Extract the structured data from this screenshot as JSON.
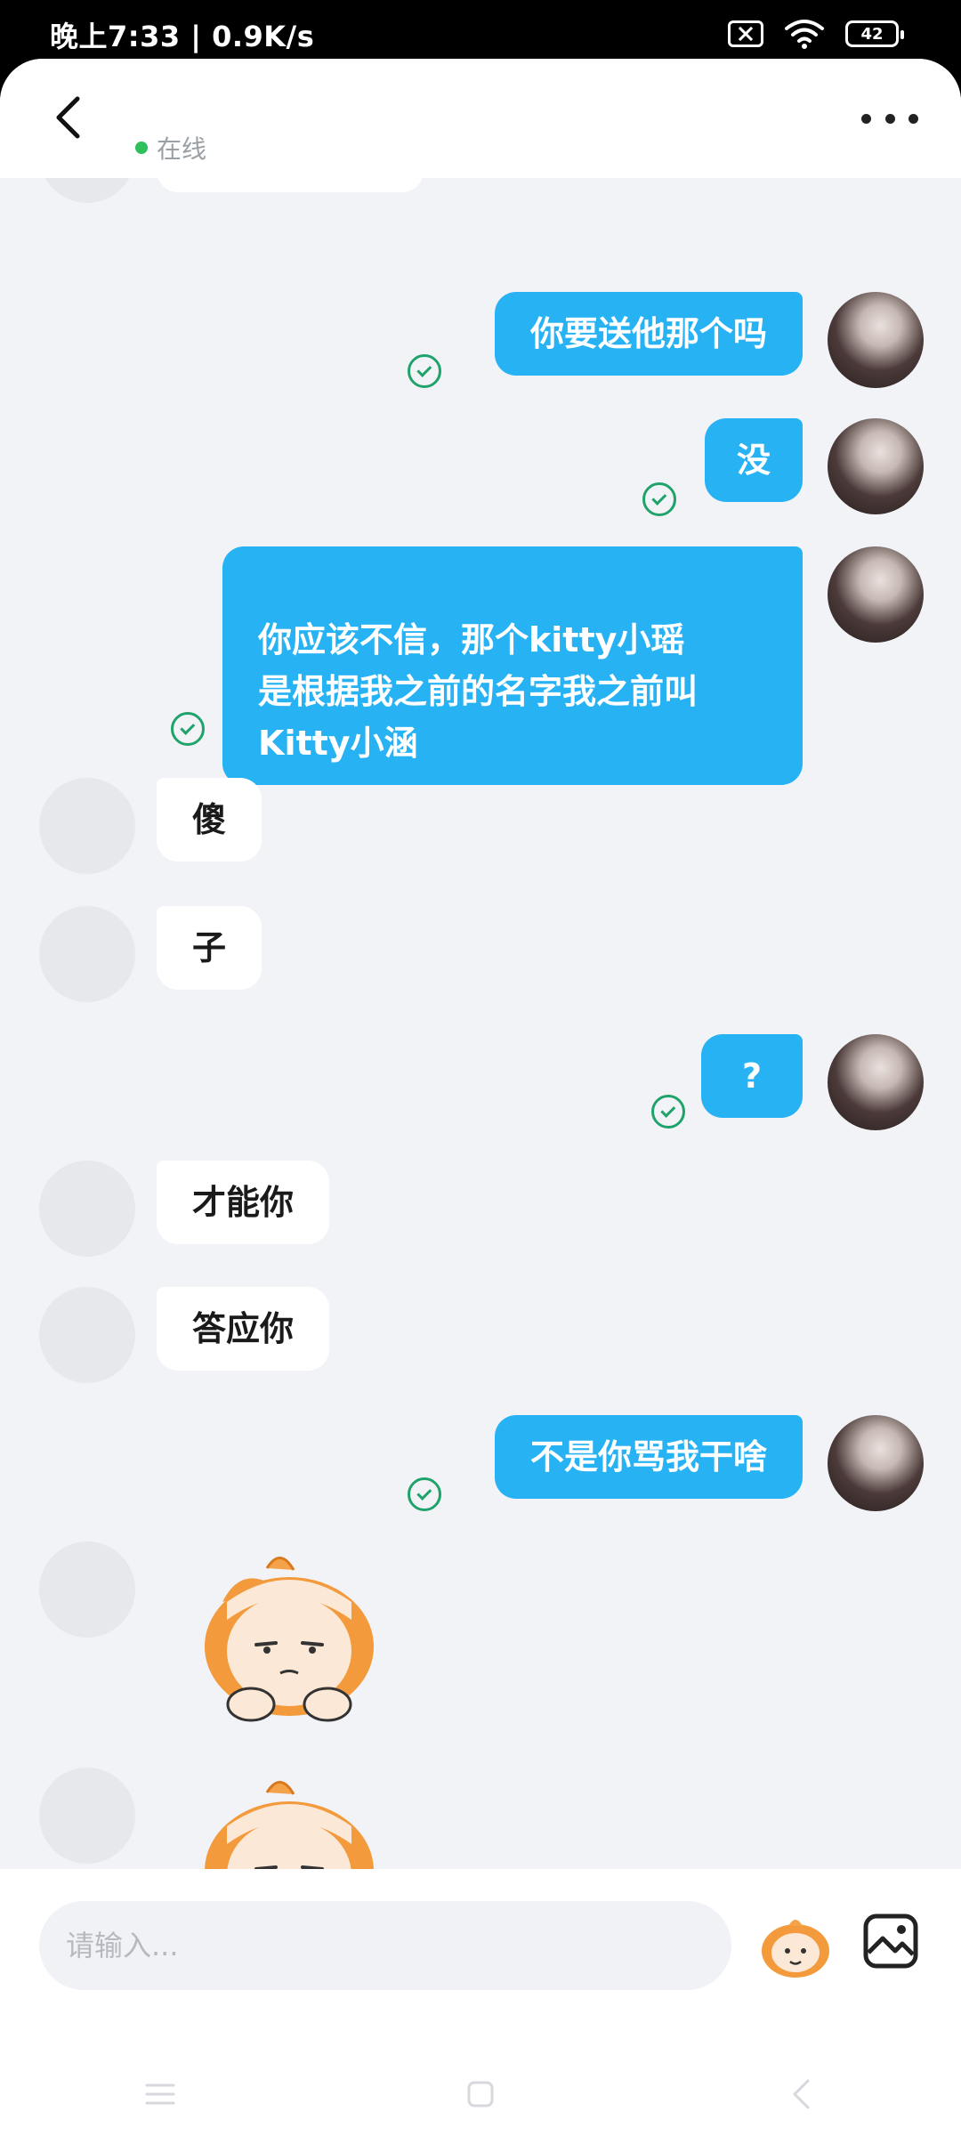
{
  "status_bar": {
    "time": "晚上7:33 | 0.9K/s",
    "battery": "42"
  },
  "header": {
    "status_text": "在线",
    "status_color": "#2ec05a"
  },
  "chat": {
    "messages": [
      {
        "from": "me",
        "text": "你要送他那个吗"
      },
      {
        "from": "me",
        "text": "没"
      },
      {
        "from": "me",
        "text": "你应该不信，那个kitty小瑶\n是根据我之前的名字我之前叫\nKitty小涵"
      },
      {
        "from": "peer",
        "text": "傻"
      },
      {
        "from": "peer",
        "text": "子"
      },
      {
        "from": "me",
        "text": "?"
      },
      {
        "from": "peer",
        "text": "才能你"
      },
      {
        "from": "peer",
        "text": "答应你"
      },
      {
        "from": "me",
        "text": "不是你骂我干啥"
      },
      {
        "from": "peer",
        "type": "sticker",
        "icon": "bored-girl-sticker"
      },
      {
        "from": "peer",
        "type": "sticker",
        "icon": "bored-girl-sticker"
      }
    ]
  },
  "input": {
    "placeholder": "请输入..."
  },
  "colors": {
    "my_bubble": "#27b2f4",
    "peer_bubble": "#ffffff",
    "chat_bg": "#f2f3f7",
    "read_check": "#1fa36a"
  }
}
